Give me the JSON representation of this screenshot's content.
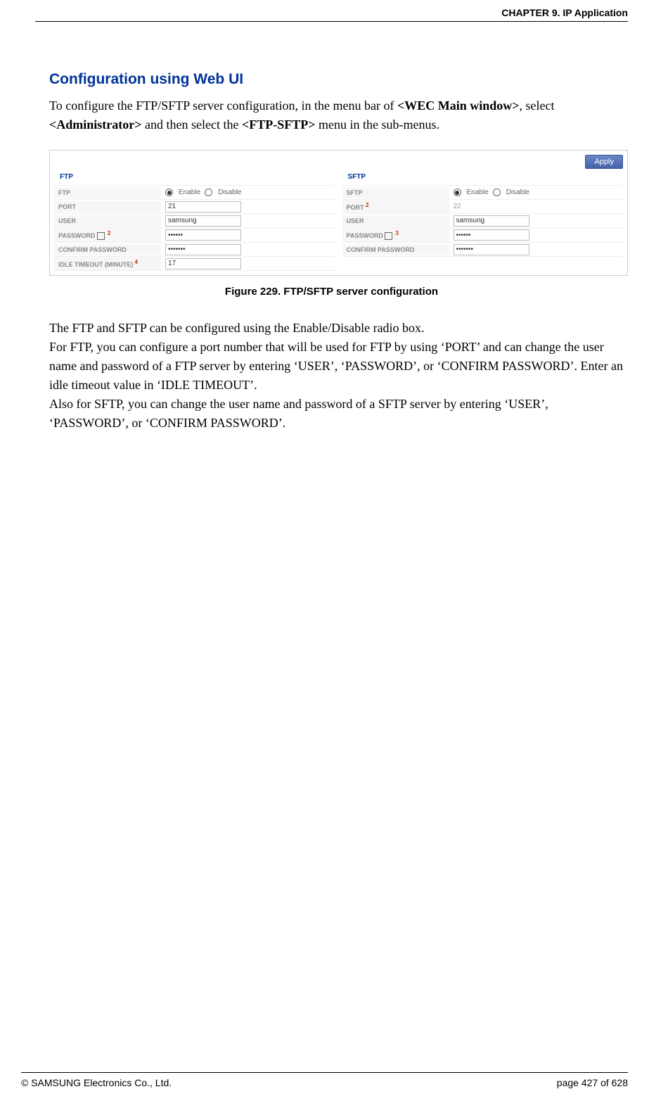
{
  "header": {
    "chapter": "CHAPTER 9. IP Application"
  },
  "section": {
    "title": "Configuration using Web UI"
  },
  "intro": {
    "p1a": "To configure the FTP/SFTP server configuration, in the menu bar of ",
    "p1b": "<WEC Main window>",
    "p1c": ", select ",
    "p1d": "<Administrator>",
    "p1e": " and then select the ",
    "p1f": "<FTP-SFTP>",
    "p1g": " menu in the sub-menus."
  },
  "figure": {
    "apply": "Apply",
    "ftpTitle": "FTP",
    "sftpTitle": "SFTP",
    "labels": {
      "ftp": "FTP",
      "port": "PORT",
      "user": "USER",
      "password": "PASSWORD",
      "confirm": "CONFIRM PASSWORD",
      "idle": "IDLE TIMEOUT (MINUTE)",
      "sftp": "SFTP"
    },
    "radio": {
      "enable": "Enable",
      "disable": "Disable"
    },
    "sup2": "2",
    "sup3": "3",
    "sup4": "4",
    "ftp": {
      "port": "21",
      "user": "samsung",
      "password": "••••••",
      "confirm": "•••••••",
      "idle": "17"
    },
    "sftp": {
      "port": "22",
      "user": "samsung",
      "password": "••••••",
      "confirm": "•••••••"
    },
    "caption": "Figure 229. FTP/SFTP server configuration"
  },
  "body": {
    "p1": "The FTP and SFTP can be configured using the Enable/Disable radio box.",
    "p2": "For FTP, you can configure a port number that will be used for FTP by using ‘PORT’ and can change the user name and password of a FTP server by entering ‘USER’, ‘PASSWORD’, or ‘CONFIRM PASSWORD’. Enter an idle timeout value in ‘IDLE TIMEOUT’.",
    "p3": "Also for SFTP, you can change the user name and password of a SFTP server by entering ‘USER’, ‘PASSWORD’, or ‘CONFIRM PASSWORD’."
  },
  "footer": {
    "copyright": "© SAMSUNG Electronics Co., Ltd.",
    "page": "page 427 of 628"
  }
}
